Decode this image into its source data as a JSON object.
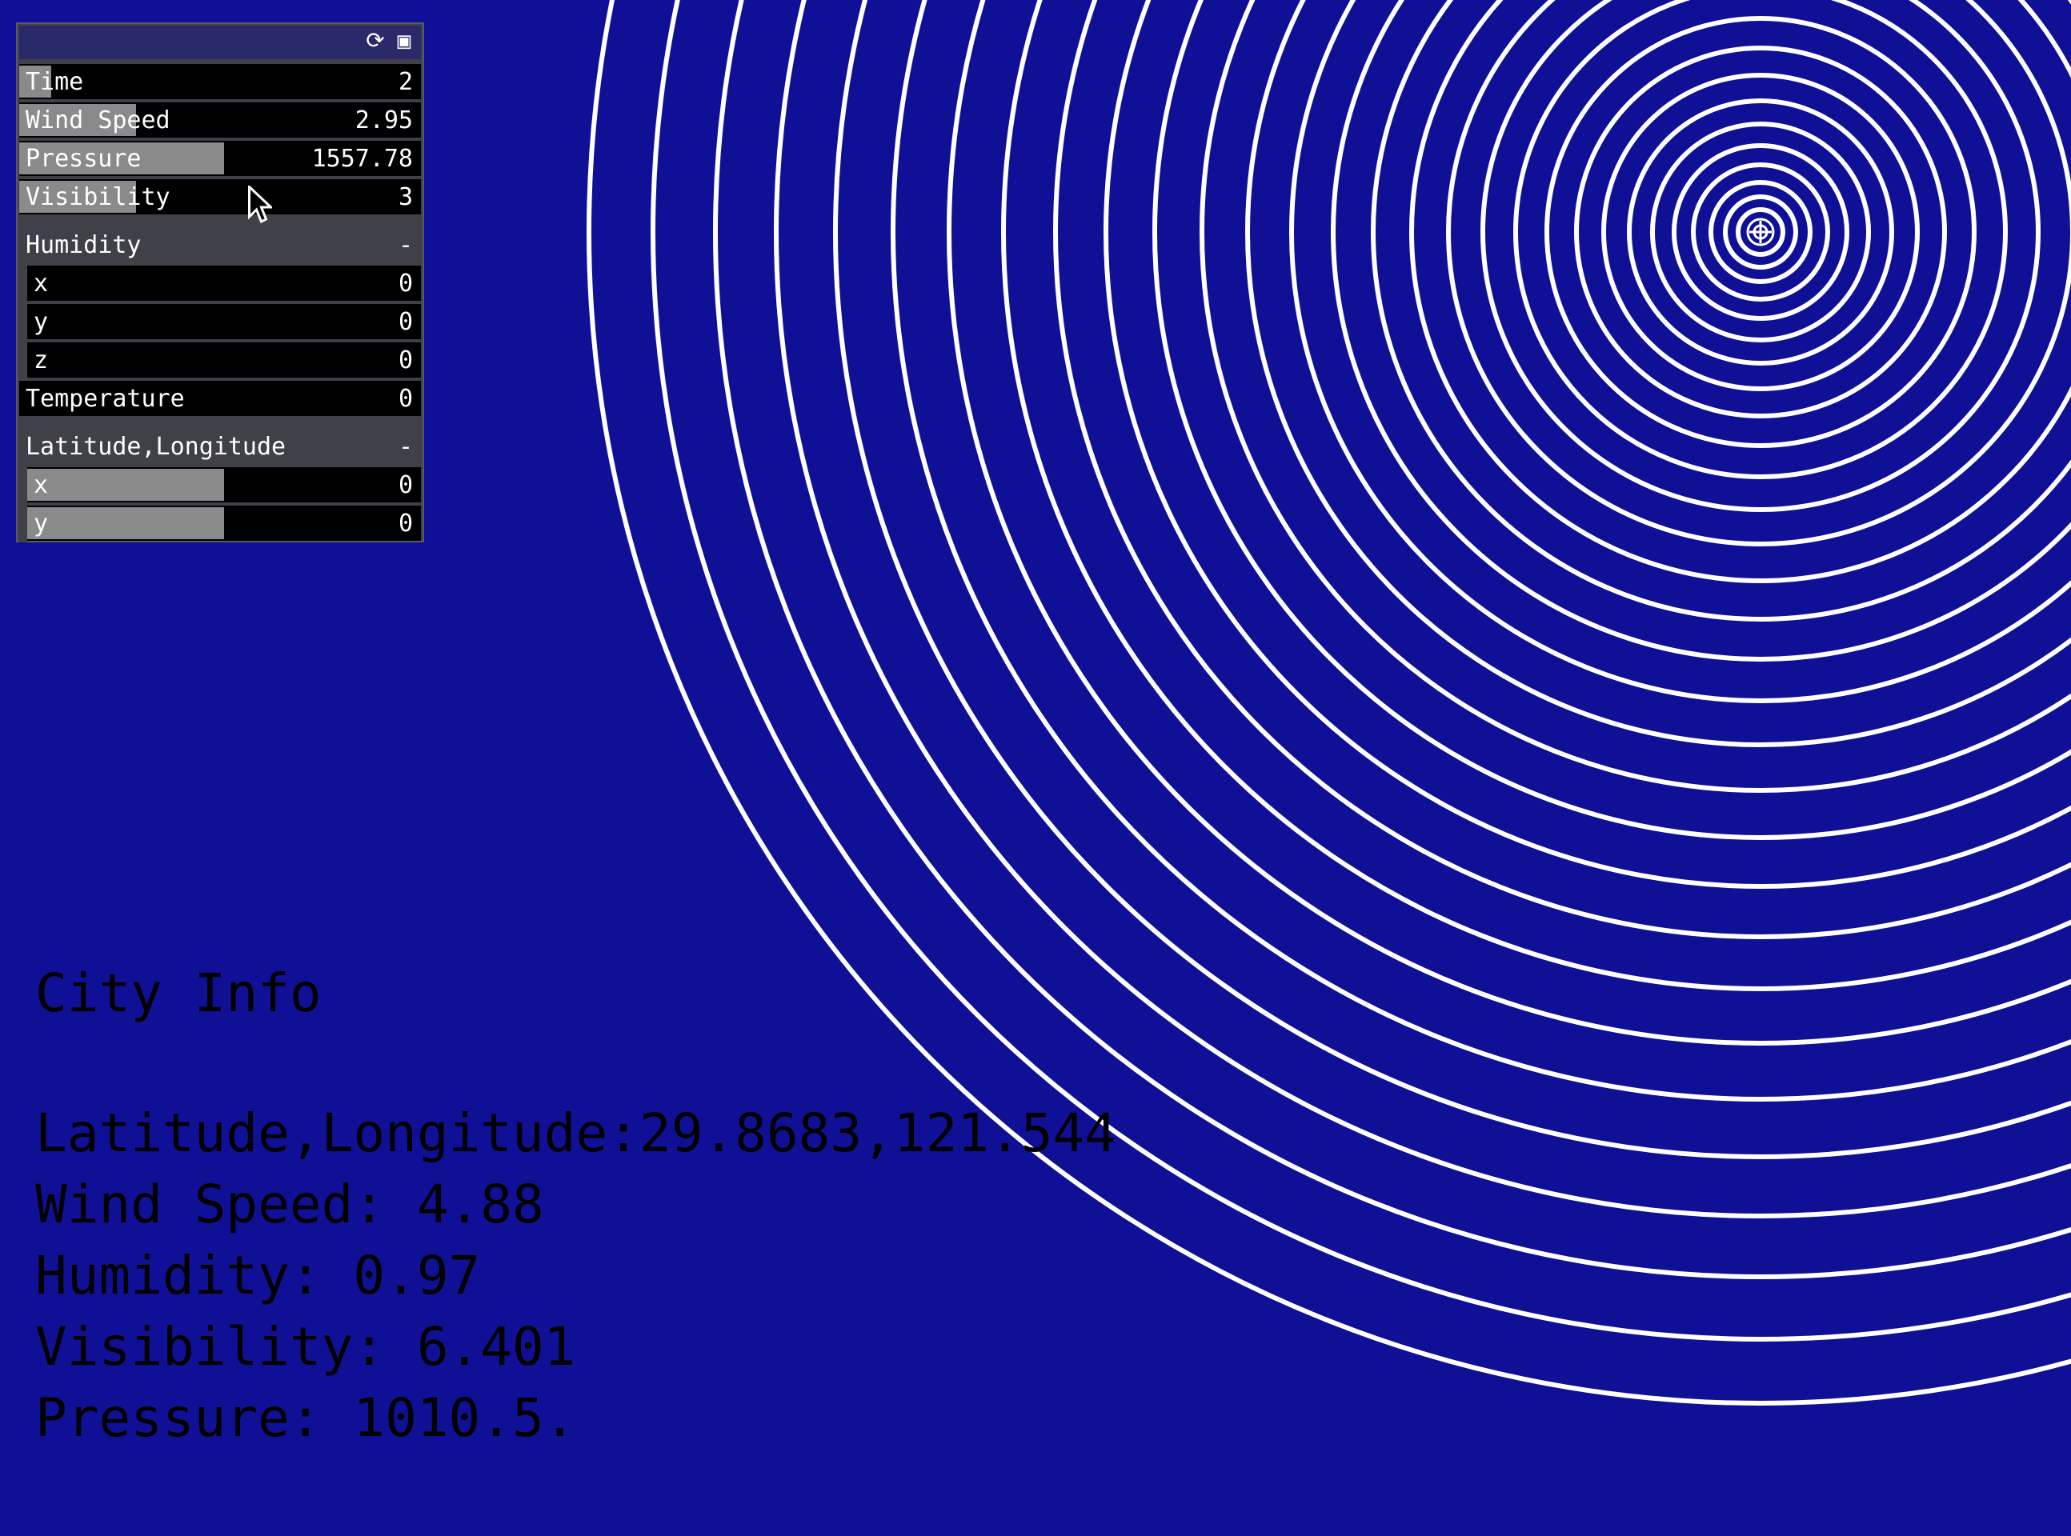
{
  "gui": {
    "header_icons": [
      "refresh-icon",
      "save-icon"
    ],
    "params": [
      {
        "label": "Time",
        "value": "2",
        "fill": 0.08
      },
      {
        "label": "Wind Speed",
        "value": "2.95",
        "fill": 0.29
      },
      {
        "label": "Pressure",
        "value": "1557.78",
        "fill": 0.51
      },
      {
        "label": "Visibility",
        "value": "3",
        "fill": 0.29
      }
    ],
    "humidity_group": {
      "title": "Humidity",
      "collapse": "-",
      "fields": [
        {
          "label": "x",
          "value": "0"
        },
        {
          "label": "y",
          "value": "0"
        },
        {
          "label": "z",
          "value": "0"
        }
      ]
    },
    "temperature": {
      "label": "Temperature",
      "value": "0"
    },
    "latlon_group": {
      "title": "Latitude,Longitude",
      "collapse": "-",
      "fields": [
        {
          "label": "x",
          "value": "0",
          "fill": 0.5
        },
        {
          "label": "y",
          "value": "0",
          "fill": 0.5
        }
      ]
    }
  },
  "city_info": {
    "title": "City Info",
    "lines": [
      "Latitude,Longitude:29.8683,121.544",
      "Wind Speed: 4.88",
      "Humidity: 0.97",
      "Visibility: 6.401",
      "Pressure: 1010.5."
    ]
  },
  "colors": {
    "background": "#101096",
    "rings": "#ffffff",
    "text": "#000000"
  }
}
